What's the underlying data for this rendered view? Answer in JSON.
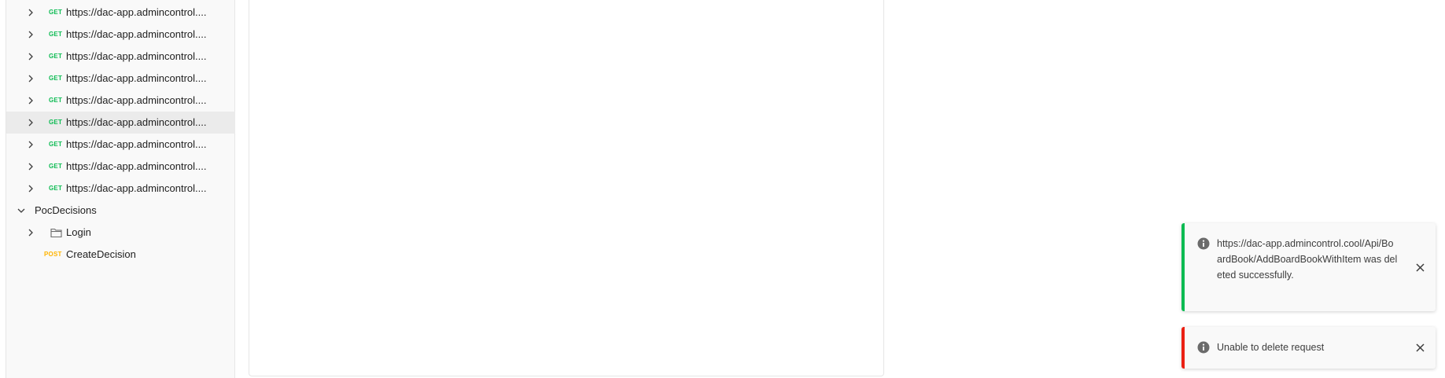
{
  "sidebar": {
    "requests": [
      {
        "method": "GET",
        "name": "https://dac-app.admincontrol...."
      },
      {
        "method": "GET",
        "name": "https://dac-app.admincontrol...."
      },
      {
        "method": "GET",
        "name": "https://dac-app.admincontrol...."
      },
      {
        "method": "GET",
        "name": "https://dac-app.admincontrol...."
      },
      {
        "method": "GET",
        "name": "https://dac-app.admincontrol...."
      },
      {
        "method": "GET",
        "name": "https://dac-app.admincontrol...."
      },
      {
        "method": "GET",
        "name": "https://dac-app.admincontrol...."
      },
      {
        "method": "GET",
        "name": "https://dac-app.admincontrol...."
      },
      {
        "method": "GET",
        "name": "https://dac-app.admincontrol...."
      }
    ],
    "selected_request_index": 5,
    "collection": {
      "name": "PocDecisions",
      "folder": {
        "name": "Login"
      },
      "request": {
        "method": "POST",
        "name": "CreateDecision"
      }
    }
  },
  "toasts": [
    {
      "type": "success",
      "accent_color": "#0cbb52",
      "icon": "info-icon",
      "message": "https://dac-app.admincontrol.cool/Api/BoardBook/AddBoardBookWithItem was deleted successfully."
    },
    {
      "type": "error",
      "accent_color": "#eb2013",
      "icon": "info-icon",
      "message": "Unable to delete request"
    }
  ],
  "colors": {
    "get_method": "#0cbb52",
    "post_method": "#ffb400",
    "sidebar_bg": "#f9f9f9",
    "selected_row_bg": "#ebebeb"
  }
}
